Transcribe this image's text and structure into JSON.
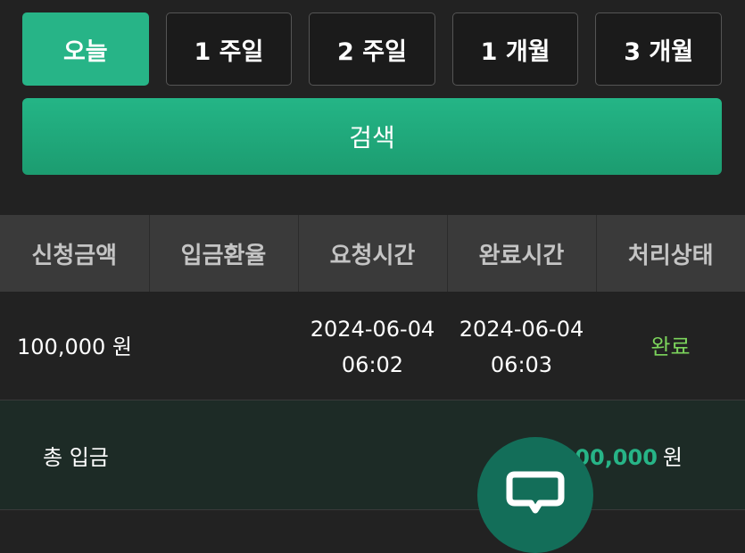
{
  "period_buttons": [
    {
      "label": "오늘",
      "active": true
    },
    {
      "label": "1 주일",
      "active": false
    },
    {
      "label": "2 주일",
      "active": false
    },
    {
      "label": "1 개월",
      "active": false
    },
    {
      "label": "3 개월",
      "active": false
    }
  ],
  "search_label": "검색",
  "table": {
    "headers": [
      "신청금액",
      "입금환율",
      "요청시간",
      "완료시간",
      "처리상태"
    ],
    "rows": [
      {
        "amount": "100,000 원",
        "rate": "",
        "request_date": "2024-06-04",
        "request_time": "06:02",
        "complete_date": "2024-06-04",
        "complete_time": "06:03",
        "status": "완료"
      }
    ]
  },
  "total": {
    "label": "총 입금",
    "value": "100,000",
    "unit": "원"
  },
  "colors": {
    "accent": "#27b487",
    "status_done": "#7cd45c",
    "background": "#222222"
  },
  "icons": {
    "chat": "chat-bubble-icon"
  }
}
